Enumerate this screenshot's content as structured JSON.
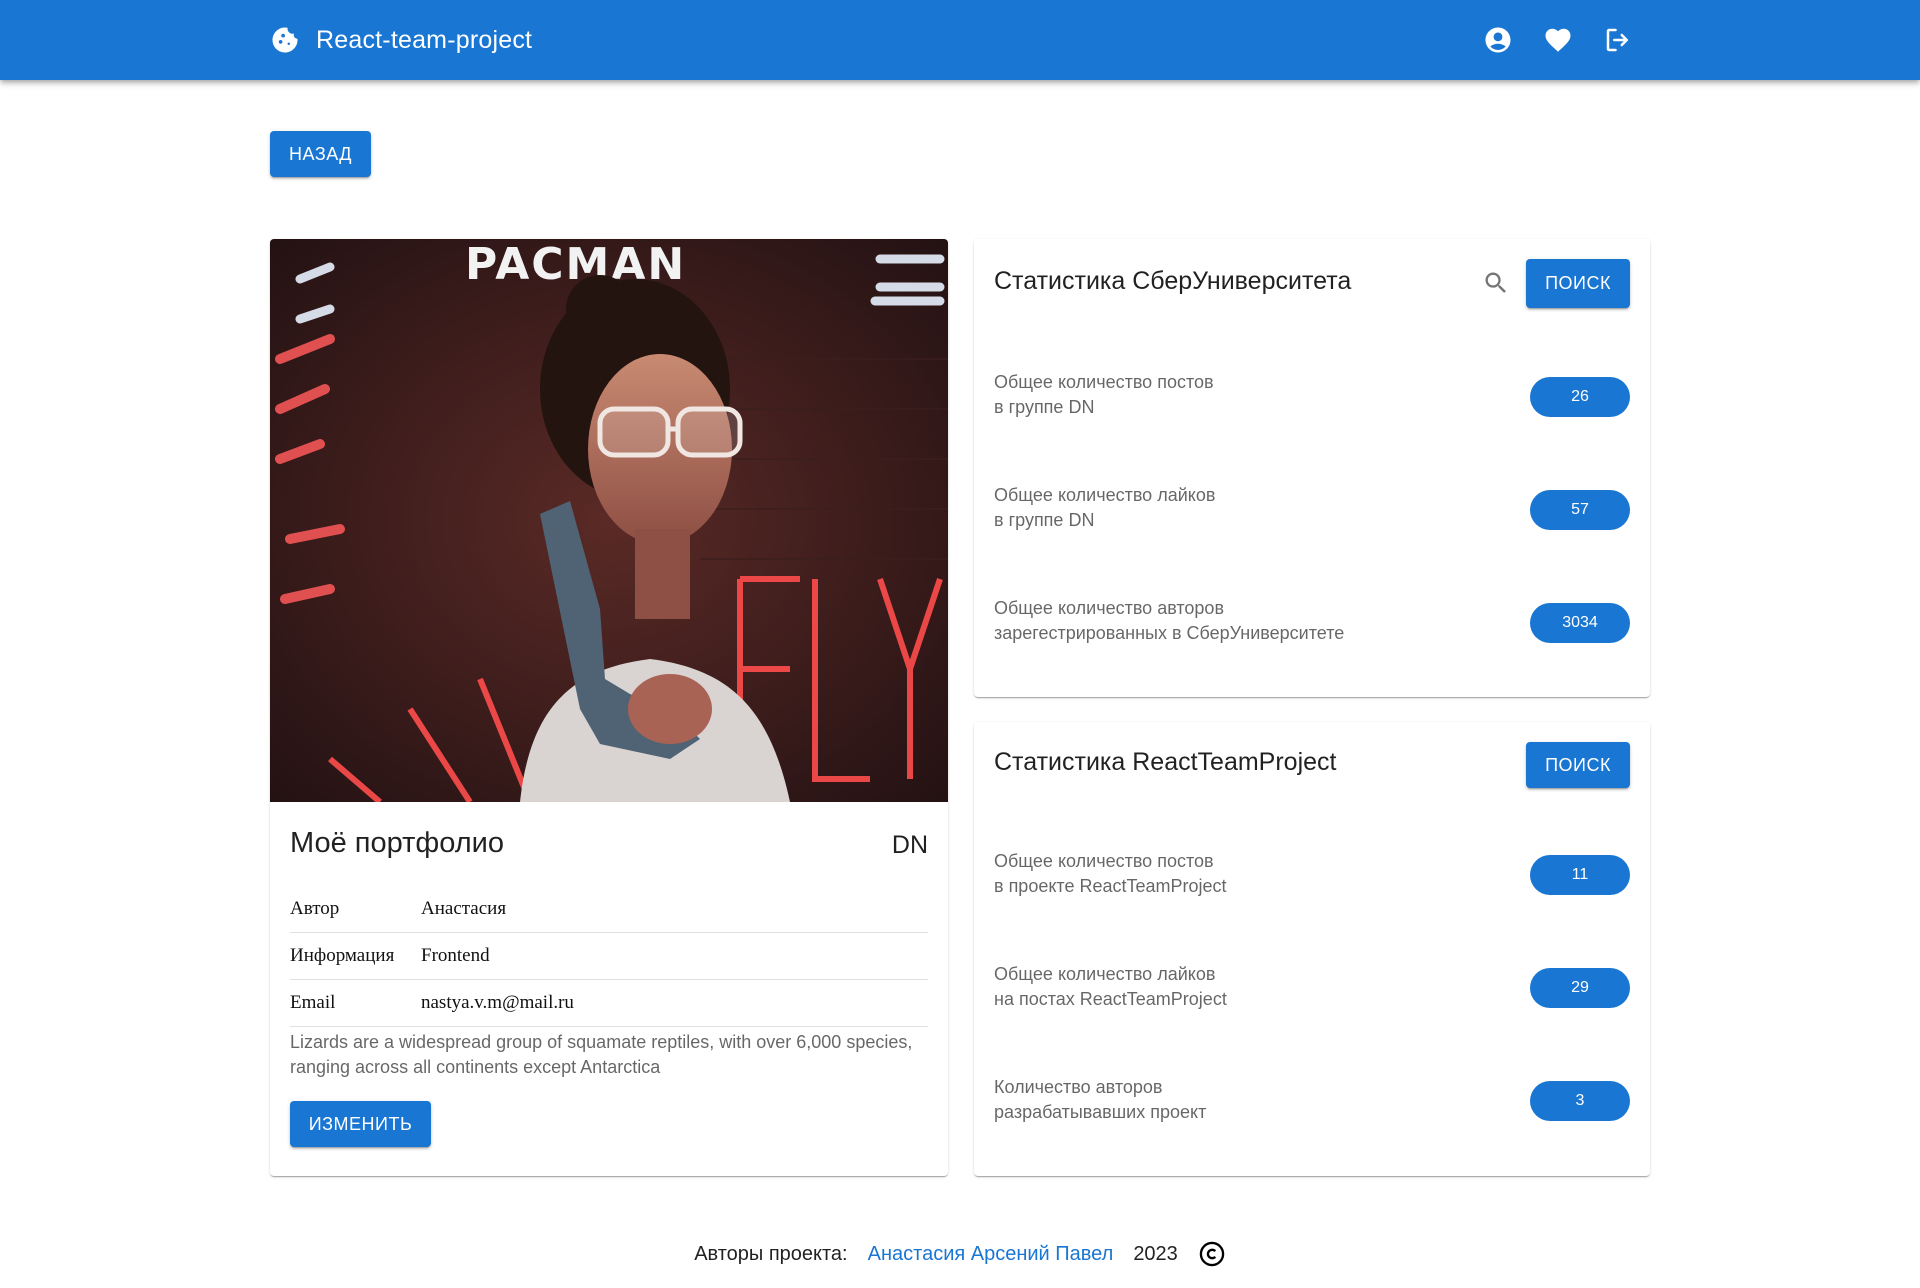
{
  "header": {
    "title": "React-team-project",
    "logo_icon": "cookie-icon",
    "icons": [
      "account-circle-icon",
      "favorite-icon",
      "logout-icon"
    ],
    "brand_color": "#1976d2"
  },
  "back_button": {
    "label": "Назад"
  },
  "portfolio": {
    "photo": "portrait-photo",
    "title": "Моё портфолио",
    "group": "DN",
    "rows": [
      {
        "key": "Автор",
        "value": "Анастасия"
      },
      {
        "key": "Информация",
        "value": "Frontend"
      },
      {
        "key": "Email",
        "value": "nastya.v.m@mail.ru"
      }
    ],
    "description": "Lizards are a widespread group of squamate reptiles, with over 6,000 species, ranging across all continents except Antarctica",
    "edit_button": "Изменить"
  },
  "sber_stats": {
    "title": "Статистика СберУниверситета",
    "search_button": "Поиск",
    "items": [
      {
        "line1": "Общее количество постов",
        "line2": "в группе DN",
        "value": "26"
      },
      {
        "line1": "Общее количество лайков",
        "line2": "в группе DN",
        "value": "57"
      },
      {
        "line1": "Общее количество авторов",
        "line2": "зарегестрированных в СберУниверситете",
        "value": "3034"
      }
    ]
  },
  "project_stats": {
    "title": "Статистика ReactTeamProject",
    "search_button": "Поиск",
    "items": [
      {
        "line1": "Общее количество постов",
        "line2": "в проекте ReactTeamProject",
        "value": "11"
      },
      {
        "line1": "Общее количество лайков",
        "line2": "на постах ReactTeamProject",
        "value": "29"
      },
      {
        "line1": "Количество авторов",
        "line2": "разрабатывавших проект",
        "value": "3"
      }
    ]
  },
  "footer": {
    "label": "Авторы проекта:",
    "authors": "Анастасия Арсений Павел",
    "year": "2023",
    "copyright_icon": "copyright-icon"
  }
}
